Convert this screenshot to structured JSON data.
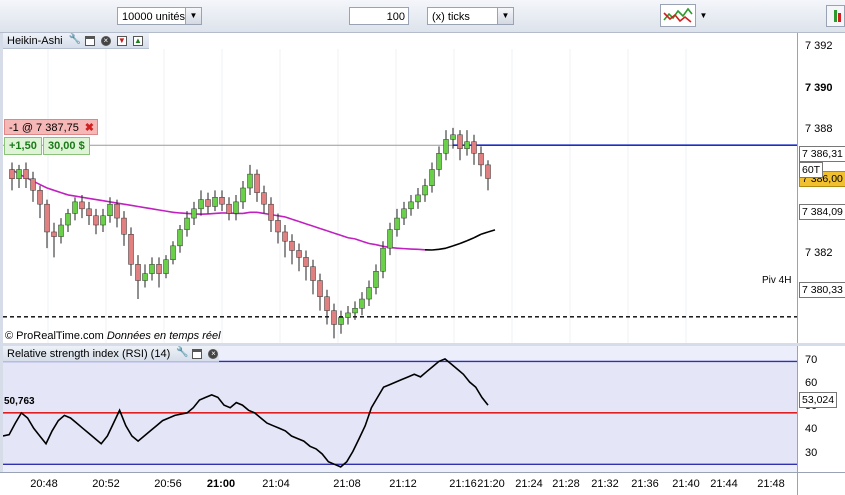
{
  "toolbar": {
    "quantity": "10000 unités",
    "ticks_value": "100",
    "ticks_unit": "(x) ticks"
  },
  "price_panel": {
    "title": "Heikin-Ashi",
    "order_label": "-1 @ 7 387,75",
    "pnl_points": "+1,50",
    "pnl_amount": "30,00 $",
    "pivot_label": "Piv 4H",
    "watermark_brand": "© ProRealTime.com",
    "watermark_note": "Données en temps réel",
    "y_ticks": [
      "7 392",
      "7 390",
      "7 388",
      "7 382"
    ],
    "tags": {
      "last": "7 386,31",
      "timeframe": "60T",
      "order": "7 386,00",
      "ma": "7 384,09",
      "pivot": "7 380,33"
    }
  },
  "rsi_panel": {
    "title": "Relative strength index (RSI) (14)",
    "current": "53,024",
    "left_value": "50,763",
    "y_ticks": [
      "70",
      "60",
      "50",
      "40",
      "30"
    ]
  },
  "x_axis": {
    "labels": [
      "20:48",
      "20:52",
      "20:56",
      "21:00",
      "21:04",
      "21:08",
      "21:12",
      "21:16",
      "21:20",
      "21:24",
      "21:28",
      "21:32",
      "21:36",
      "21:40",
      "21:44",
      "21:48"
    ]
  },
  "colors": {
    "bull": "#6ad04a",
    "bear": "#e08080",
    "ma_below": "#c020c0",
    "ma_above": "#000000",
    "order_line": "#1a2fc8",
    "rsi_bound": "#3030b0",
    "rsi_mid": "#e02020"
  },
  "chart_data": [
    {
      "type": "candlestick",
      "title": "Heikin-Ashi",
      "ylim": [
        7379.2,
        7392.6
      ],
      "last_price": 7386.31,
      "order_level": 7387.75,
      "ma_value": 7384.09,
      "pivot_level": 7380.33,
      "candles": [
        {
          "o": 7386.7,
          "c": 7386.3,
          "h": 7387.0,
          "l": 7385.8
        },
        {
          "o": 7386.3,
          "c": 7386.7,
          "h": 7386.9,
          "l": 7385.9
        },
        {
          "o": 7386.7,
          "c": 7386.3,
          "h": 7387.0,
          "l": 7385.9
        },
        {
          "o": 7386.3,
          "c": 7385.8,
          "h": 7386.6,
          "l": 7385.3
        },
        {
          "o": 7385.8,
          "c": 7385.2,
          "h": 7386.0,
          "l": 7384.6
        },
        {
          "o": 7385.2,
          "c": 7384.0,
          "h": 7385.4,
          "l": 7383.3
        },
        {
          "o": 7384.0,
          "c": 7383.8,
          "h": 7384.4,
          "l": 7382.9
        },
        {
          "o": 7383.8,
          "c": 7384.3,
          "h": 7384.6,
          "l": 7383.5
        },
        {
          "o": 7384.3,
          "c": 7384.8,
          "h": 7385.0,
          "l": 7384.0
        },
        {
          "o": 7384.8,
          "c": 7385.3,
          "h": 7385.5,
          "l": 7384.5
        },
        {
          "o": 7385.3,
          "c": 7385.0,
          "h": 7385.6,
          "l": 7384.6
        },
        {
          "o": 7385.0,
          "c": 7384.7,
          "h": 7385.3,
          "l": 7384.3
        },
        {
          "o": 7384.7,
          "c": 7384.3,
          "h": 7385.0,
          "l": 7383.9
        },
        {
          "o": 7384.3,
          "c": 7384.7,
          "h": 7385.0,
          "l": 7384.0
        },
        {
          "o": 7384.7,
          "c": 7385.2,
          "h": 7385.5,
          "l": 7384.4
        },
        {
          "o": 7385.2,
          "c": 7384.6,
          "h": 7385.4,
          "l": 7384.2
        },
        {
          "o": 7384.6,
          "c": 7383.9,
          "h": 7384.9,
          "l": 7383.4
        },
        {
          "o": 7383.9,
          "c": 7382.6,
          "h": 7384.2,
          "l": 7382.1
        },
        {
          "o": 7382.6,
          "c": 7381.9,
          "h": 7383.0,
          "l": 7381.1
        },
        {
          "o": 7381.9,
          "c": 7382.2,
          "h": 7382.6,
          "l": 7381.6
        },
        {
          "o": 7382.2,
          "c": 7382.6,
          "h": 7382.9,
          "l": 7381.9
        },
        {
          "o": 7382.6,
          "c": 7382.2,
          "h": 7382.9,
          "l": 7381.6
        },
        {
          "o": 7382.2,
          "c": 7382.8,
          "h": 7383.0,
          "l": 7382.0
        },
        {
          "o": 7382.8,
          "c": 7383.4,
          "h": 7383.6,
          "l": 7382.6
        },
        {
          "o": 7383.4,
          "c": 7384.1,
          "h": 7384.3,
          "l": 7383.1
        },
        {
          "o": 7384.1,
          "c": 7384.6,
          "h": 7384.9,
          "l": 7383.8
        },
        {
          "o": 7384.6,
          "c": 7385.0,
          "h": 7385.3,
          "l": 7384.3
        },
        {
          "o": 7385.0,
          "c": 7385.4,
          "h": 7385.8,
          "l": 7384.7
        },
        {
          "o": 7385.4,
          "c": 7385.1,
          "h": 7385.7,
          "l": 7384.8
        },
        {
          "o": 7385.1,
          "c": 7385.5,
          "h": 7385.8,
          "l": 7384.9
        },
        {
          "o": 7385.5,
          "c": 7385.2,
          "h": 7385.8,
          "l": 7384.9
        },
        {
          "o": 7385.2,
          "c": 7384.8,
          "h": 7385.5,
          "l": 7384.5
        },
        {
          "o": 7384.8,
          "c": 7385.3,
          "h": 7385.6,
          "l": 7384.5
        },
        {
          "o": 7385.3,
          "c": 7385.9,
          "h": 7386.2,
          "l": 7385.0
        },
        {
          "o": 7385.9,
          "c": 7386.5,
          "h": 7386.9,
          "l": 7385.6
        },
        {
          "o": 7386.5,
          "c": 7385.7,
          "h": 7386.7,
          "l": 7385.3
        },
        {
          "o": 7385.7,
          "c": 7385.2,
          "h": 7386.0,
          "l": 7384.8
        },
        {
          "o": 7385.2,
          "c": 7384.5,
          "h": 7385.5,
          "l": 7384.0
        },
        {
          "o": 7384.5,
          "c": 7384.0,
          "h": 7384.8,
          "l": 7383.5
        },
        {
          "o": 7384.0,
          "c": 7383.6,
          "h": 7384.3,
          "l": 7382.9
        },
        {
          "o": 7383.6,
          "c": 7383.2,
          "h": 7383.9,
          "l": 7382.6
        },
        {
          "o": 7383.2,
          "c": 7382.9,
          "h": 7383.5,
          "l": 7382.3
        },
        {
          "o": 7382.9,
          "c": 7382.5,
          "h": 7383.2,
          "l": 7381.9
        },
        {
          "o": 7382.5,
          "c": 7381.9,
          "h": 7382.8,
          "l": 7381.3
        },
        {
          "o": 7381.9,
          "c": 7381.2,
          "h": 7382.2,
          "l": 7380.6
        },
        {
          "o": 7381.2,
          "c": 7380.6,
          "h": 7381.5,
          "l": 7380.0
        },
        {
          "o": 7380.6,
          "c": 7380.0,
          "h": 7380.9,
          "l": 7379.4
        },
        {
          "o": 7380.0,
          "c": 7380.3,
          "h": 7380.6,
          "l": 7379.6
        },
        {
          "o": 7380.3,
          "c": 7380.5,
          "h": 7380.8,
          "l": 7380.0
        },
        {
          "o": 7380.5,
          "c": 7380.7,
          "h": 7381.0,
          "l": 7380.2
        },
        {
          "o": 7380.7,
          "c": 7381.1,
          "h": 7381.4,
          "l": 7380.4
        },
        {
          "o": 7381.1,
          "c": 7381.6,
          "h": 7381.9,
          "l": 7380.8
        },
        {
          "o": 7381.6,
          "c": 7382.3,
          "h": 7382.6,
          "l": 7381.3
        },
        {
          "o": 7382.3,
          "c": 7383.3,
          "h": 7383.6,
          "l": 7382.0
        },
        {
          "o": 7383.3,
          "c": 7384.1,
          "h": 7384.4,
          "l": 7383.0
        },
        {
          "o": 7384.1,
          "c": 7384.6,
          "h": 7385.0,
          "l": 7383.8
        },
        {
          "o": 7384.6,
          "c": 7385.0,
          "h": 7385.3,
          "l": 7384.3
        },
        {
          "o": 7385.0,
          "c": 7385.3,
          "h": 7385.6,
          "l": 7384.7
        },
        {
          "o": 7385.3,
          "c": 7385.6,
          "h": 7385.9,
          "l": 7385.0
        },
        {
          "o": 7385.6,
          "c": 7386.0,
          "h": 7386.3,
          "l": 7385.3
        },
        {
          "o": 7386.0,
          "c": 7386.7,
          "h": 7387.0,
          "l": 7385.7
        },
        {
          "o": 7386.7,
          "c": 7387.4,
          "h": 7387.7,
          "l": 7386.4
        },
        {
          "o": 7387.4,
          "c": 7388.0,
          "h": 7388.4,
          "l": 7387.1
        },
        {
          "o": 7388.0,
          "c": 7388.2,
          "h": 7388.5,
          "l": 7387.6
        },
        {
          "o": 7388.2,
          "c": 7387.6,
          "h": 7388.4,
          "l": 7387.1
        },
        {
          "o": 7387.6,
          "c": 7387.9,
          "h": 7388.4,
          "l": 7387.3
        },
        {
          "o": 7387.9,
          "c": 7387.4,
          "h": 7388.2,
          "l": 7386.9
        },
        {
          "o": 7387.4,
          "c": 7386.9,
          "h": 7387.7,
          "l": 7386.4
        },
        {
          "o": 7386.9,
          "c": 7386.31,
          "h": 7387.1,
          "l": 7385.8
        }
      ],
      "moving_average": [
        7386.7,
        7386.5,
        7386.35,
        7386.2,
        7386.05,
        7385.9,
        7385.8,
        7385.7,
        7385.6,
        7385.55,
        7385.5,
        7385.45,
        7385.4,
        7385.35,
        7385.3,
        7385.25,
        7385.2,
        7385.15,
        7385.1,
        7385.05,
        7385.0,
        7384.95,
        7384.9,
        7384.85,
        7384.82,
        7384.8,
        7384.78,
        7384.77,
        7384.78,
        7384.8,
        7384.82,
        7384.82,
        7384.8,
        7384.8,
        7384.85,
        7384.85,
        7384.8,
        7384.75,
        7384.7,
        7384.65,
        7384.55,
        7384.45,
        7384.35,
        7384.25,
        7384.15,
        7384.05,
        7383.95,
        7383.85,
        7383.75,
        7383.7,
        7383.6,
        7383.5,
        7383.45,
        7383.38,
        7383.33,
        7383.3,
        7383.28,
        7383.26,
        7383.25,
        7383.23,
        7383.22,
        7383.25,
        7383.3,
        7383.4,
        7383.5,
        7383.62,
        7383.75,
        7383.9,
        7384.0,
        7384.09
      ]
    },
    {
      "type": "line",
      "title": "Relative strength index (RSI) (14)",
      "ylim": [
        27,
        76
      ],
      "bounds": [
        30,
        50,
        70
      ],
      "values": [
        41,
        41.5,
        46,
        50,
        48,
        44,
        41,
        38,
        43,
        47,
        49,
        48,
        46,
        44,
        42,
        40,
        38,
        41,
        46,
        51,
        45,
        41,
        39,
        41,
        43,
        45,
        47,
        48,
        49,
        49.5,
        50,
        52,
        55,
        56,
        57,
        56,
        53,
        52,
        54,
        53,
        51,
        50,
        48,
        46,
        45,
        44,
        43,
        41,
        40,
        39,
        37,
        36,
        34,
        31,
        30,
        29,
        31,
        35,
        40,
        45,
        52,
        56,
        60,
        61,
        62,
        63,
        64,
        65,
        64,
        66,
        68,
        70,
        71,
        69,
        67,
        65,
        62,
        60,
        56,
        53
      ]
    }
  ]
}
